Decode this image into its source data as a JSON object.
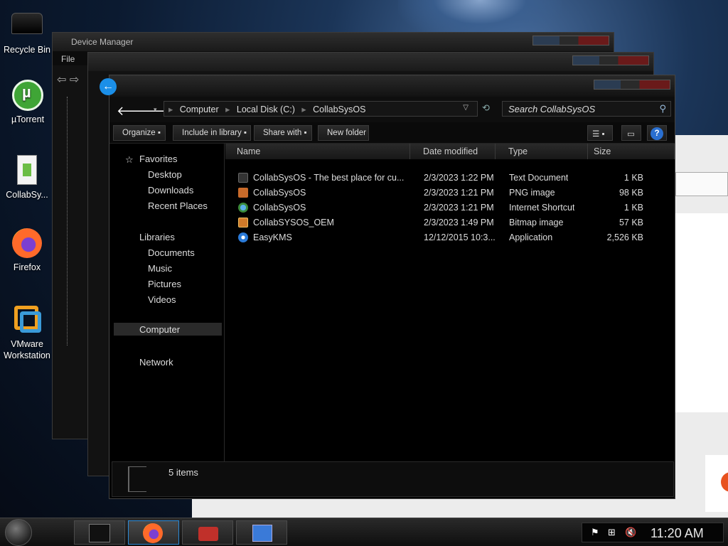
{
  "desktop": {
    "icons": [
      {
        "label": "Recycle Bin"
      },
      {
        "label": "µTorrent"
      },
      {
        "label": "CollabSy..."
      },
      {
        "label": "Firefox"
      },
      {
        "label": "VMware Workstation"
      }
    ]
  },
  "device_manager": {
    "title": "Device Manager",
    "menu_file": "File"
  },
  "explorer": {
    "breadcrumb": [
      "Computer",
      "Local Disk (C:)",
      "CollabSysOS"
    ],
    "search_placeholder": "Search CollabSysOS",
    "toolbar": {
      "organize": "Organize",
      "include_in_library": "Include in library",
      "share_with": "Share with",
      "new_folder": "New folder"
    },
    "nav": {
      "favorites": "Favorites",
      "desktop": "Desktop",
      "downloads": "Downloads",
      "recent_places": "Recent Places",
      "libraries": "Libraries",
      "documents": "Documents",
      "music": "Music",
      "pictures": "Pictures",
      "videos": "Videos",
      "computer": "Computer",
      "network": "Network"
    },
    "columns": {
      "name": "Name",
      "date_modified": "Date modified",
      "type": "Type",
      "size": "Size"
    },
    "files": [
      {
        "name": "CollabSysOS - The best place for cu...",
        "date": "2/3/2023 1:22 PM",
        "type": "Text Document",
        "size": "1 KB"
      },
      {
        "name": "CollabSysOS",
        "date": "2/3/2023 1:21 PM",
        "type": "PNG image",
        "size": "98 KB"
      },
      {
        "name": "CollabSysOS",
        "date": "2/3/2023 1:21 PM",
        "type": "Internet Shortcut",
        "size": "1 KB"
      },
      {
        "name": "CollabSYSOS_OEM",
        "date": "2/3/2023 1:49 PM",
        "type": "Bitmap image",
        "size": "57 KB"
      },
      {
        "name": "EasyKMS",
        "date": "12/12/2015 10:3...",
        "type": "Application",
        "size": "2,526 KB"
      }
    ],
    "status_text": "5 items"
  },
  "taskbar": {
    "clock": "11:20 AM"
  },
  "icons": {
    "back": "back-arrow-icon",
    "forward": "forward-arrow-icon",
    "search": "magnifier-icon",
    "help": "help-icon"
  }
}
